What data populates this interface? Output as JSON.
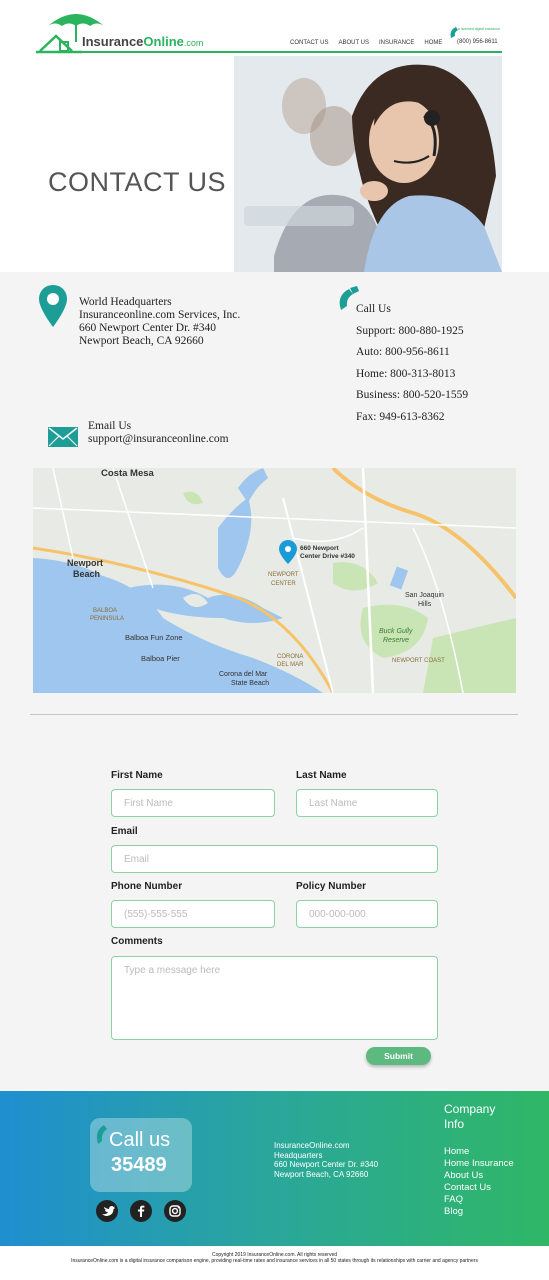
{
  "header": {
    "logo_main": "Insurance",
    "logo_accent": "Online",
    "logo_suffix": ".com",
    "nav": [
      "CONTACT US",
      "ABOUT US",
      "INSURANCE",
      "HOME"
    ],
    "phone_tag": "a licensed digital insurance",
    "phone_number": "(800) 956-8611"
  },
  "hero": {
    "title": "CONTACT US"
  },
  "headquarters": {
    "lines": [
      "World Headquarters",
      "Insuranceonline.com Services, Inc.",
      "660 Newport Center Dr. #340",
      "Newport Beach, CA 92660"
    ]
  },
  "call": {
    "title": "Call Us",
    "lines": [
      "Support: 800-880-1925",
      "Auto: 800-956-8611",
      "Home: 800-313-8013",
      "Business: 800-520-1559",
      "Fax: 949-613-8362"
    ]
  },
  "email": {
    "title": "Email Us",
    "address": "support@insuranceonline.com"
  },
  "map": {
    "pin_label_1": "660 Newport",
    "pin_label_2": "Center Drive #340",
    "places": [
      "Costa Mesa",
      "Newport",
      "Beach",
      "NEWPORT",
      "CENTER",
      "BALBOA",
      "PENINSULA",
      "Balboa Fun Zone",
      "Balboa Pier",
      "CORONA",
      "DEL MAR",
      "Corona del Mar",
      "State Beach",
      "San Joaquin",
      "Hills",
      "Buck Gully",
      "Reserve",
      "NEWPORT COAST"
    ]
  },
  "form": {
    "first_name_label": "First Name",
    "first_name_placeholder": "First Name",
    "last_name_label": "Last Name",
    "last_name_placeholder": "Last Name",
    "email_label": "Email",
    "email_placeholder": "Email",
    "phone_label": "Phone Number",
    "phone_placeholder": "(555)-555-555",
    "policy_label": "Policy Number",
    "policy_placeholder": "000-000-000",
    "comments_label": "Comments",
    "comments_placeholder": "Type a message here",
    "submit_label": "Submit"
  },
  "footer": {
    "callus_title": "Call us",
    "callus_number": "35489",
    "hq_lines": [
      "InsuranceOnline.com",
      "Headquarters",
      "660 Newport Center Dr. #340",
      "Newport Beach, CA 92660"
    ],
    "company_title_1": "Company",
    "company_title_2": "Info",
    "links": [
      "Home",
      "Home Insurance",
      "About Us",
      "Contact Us",
      "FAQ",
      "Blog"
    ],
    "social": [
      "twitter-icon",
      "facebook-icon",
      "instagram-icon"
    ]
  },
  "bottom": {
    "copyright": "Copyright 2019 InsuranceOnline.com. All rights reserved",
    "legal": "InsuranceOnline.com is a digital insurance comparison engine, providing real-time rates and insurance services in all 50 states through its relationships with carrier and agency partners"
  },
  "colors": {
    "brand_green": "#2bb35e",
    "teal": "#1c9e97",
    "footer_start": "#1f8fd0",
    "footer_end": "#2fb766"
  }
}
